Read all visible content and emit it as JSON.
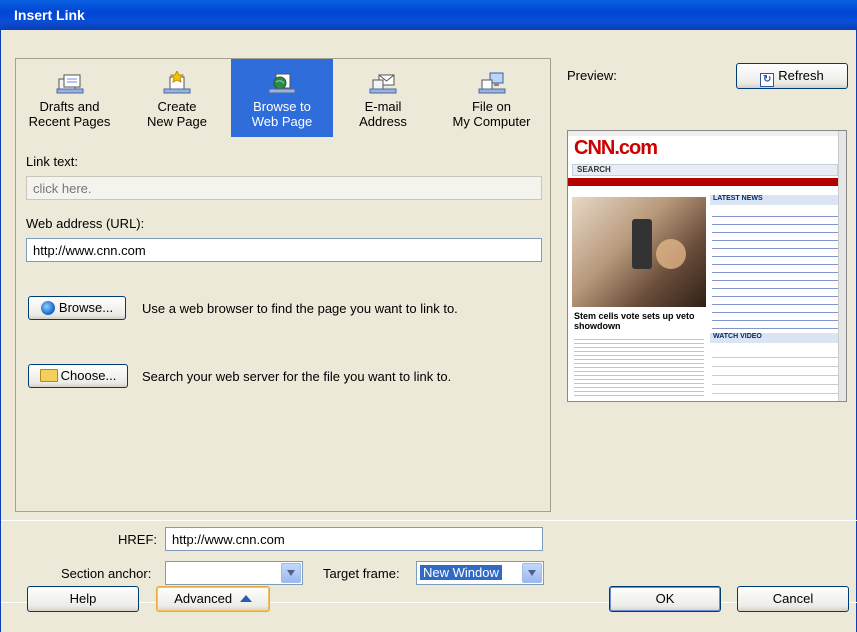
{
  "window": {
    "title": "Insert Link"
  },
  "tabs": [
    {
      "line1": "Drafts and",
      "line2": "Recent Pages",
      "icon": "drafts-icon"
    },
    {
      "line1": "Create",
      "line2": "New Page",
      "icon": "new-page-icon"
    },
    {
      "line1": "Browse to",
      "line2": "Web Page",
      "icon": "globe-page-icon"
    },
    {
      "line1": "E-mail",
      "line2": "Address",
      "icon": "email-icon"
    },
    {
      "line1": "File on",
      "line2": "My Computer",
      "icon": "computer-icon"
    }
  ],
  "link_text": {
    "label": "Link text:",
    "placeholder": "click here."
  },
  "url": {
    "label": "Web address (URL):",
    "value": "http://www.cnn.com"
  },
  "browse": {
    "label": "Browse...",
    "description": "Use a web browser to find the page you want to link to."
  },
  "choose": {
    "label": "Choose...",
    "description": "Search your web server for the file you want to link to."
  },
  "preview": {
    "label": "Preview:",
    "refresh_label": "Refresh",
    "site": {
      "logo": "CNN.com",
      "search_label": "SEARCH",
      "headline": "Stem cells vote sets up veto showdown",
      "latest_news": "LATEST NEWS",
      "watch_video": "WATCH VIDEO"
    }
  },
  "href": {
    "label": "HREF:",
    "value": "http://www.cnn.com"
  },
  "section_anchor": {
    "label": "Section anchor:",
    "value": ""
  },
  "target_frame": {
    "label": "Target frame:",
    "value": "New Window"
  },
  "footer": {
    "help": "Help",
    "advanced": "Advanced",
    "ok": "OK",
    "cancel": "Cancel"
  }
}
